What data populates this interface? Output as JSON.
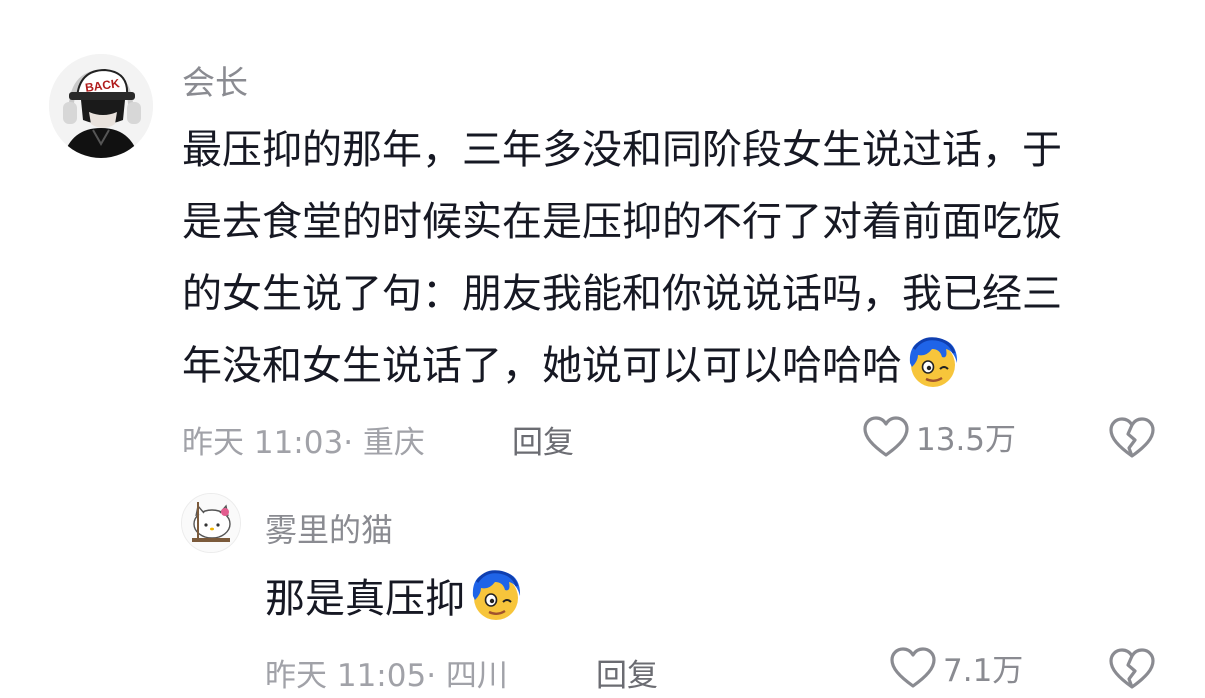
{
  "comments": [
    {
      "username": "会长",
      "content_lines": [
        "最压抑的那年，三年多没和同阶段女生说过话，于",
        "是去食堂的时候实在是压抑的不行了对着前面吃饭",
        "的女生说了句：朋友我能和你说说话吗，我已经三",
        "年没和女生说话了，她说可以可以哈哈哈"
      ],
      "emoji": "blue-hair-face-emoji",
      "time_location": "昨天 11:03· 重庆",
      "reply_label": "回复",
      "like_count": "13.5万",
      "avatar_icon": "avatar-back-cap-boy",
      "avatar_text": "BACK"
    },
    {
      "username": "雾里的猫",
      "content_lines": [
        "那是真压抑"
      ],
      "emoji": "blue-hair-face-emoji",
      "time_location": "昨天 11:05· 四川",
      "reply_label": "回复",
      "like_count": "7.1万",
      "avatar_icon": "avatar-hello-kitty"
    }
  ],
  "colors": {
    "text": "#161823",
    "secondary": "#8a8b91",
    "meta": "#a1a2a8",
    "reply": "#6b6c72"
  },
  "icons": [
    "heart-outline-icon",
    "broken-heart-icon"
  ]
}
